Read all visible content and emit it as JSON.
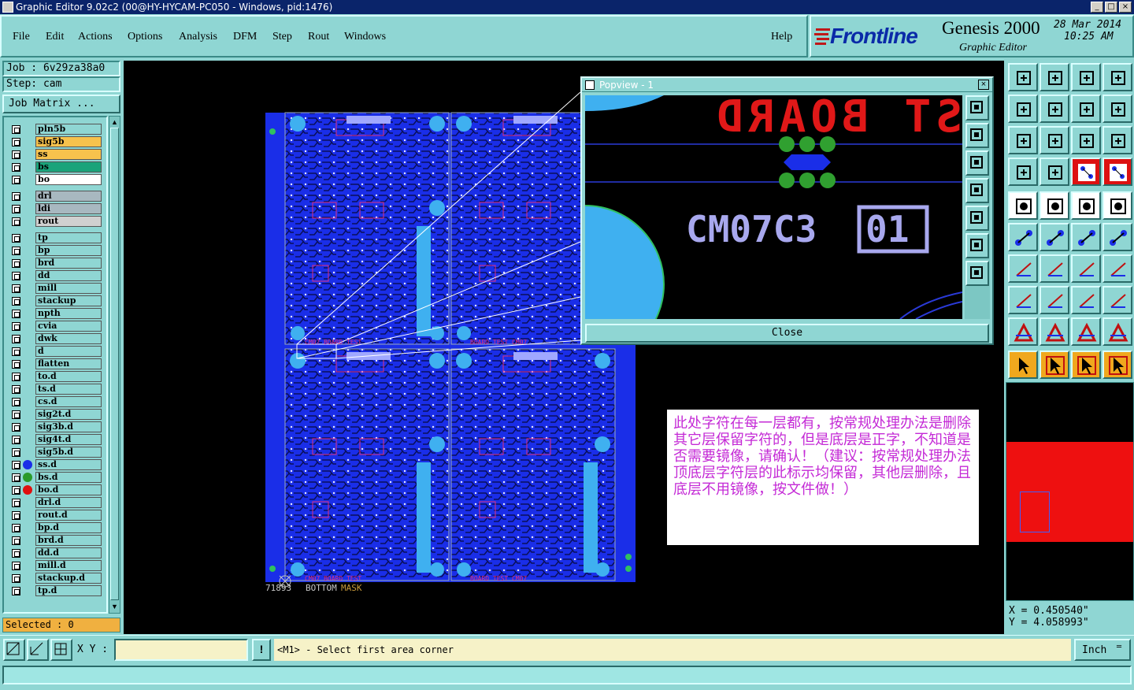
{
  "window": {
    "title": "Graphic Editor 9.02c2 (00@HY-HYCAM-PC050 - Windows, pid:1476)",
    "controls": [
      "_",
      "□",
      "×"
    ]
  },
  "menu": {
    "items": [
      "File",
      "Edit",
      "Actions",
      "Options",
      "Analysis",
      "DFM",
      "Step",
      "Rout",
      "Windows"
    ],
    "help": "Help"
  },
  "brand": {
    "logo": "Frontline",
    "product": "Genesis 2000",
    "subtitle": "Graphic Editor",
    "date": "28 Mar 2014",
    "time": "10:25 AM"
  },
  "job": {
    "job_label": "Job : 6v29za38a0",
    "step_label": "Step: cam",
    "matrix_button": "Job Matrix ..."
  },
  "layers": [
    {
      "name": "pln5b",
      "color": "#8fd6d3",
      "dot": ""
    },
    {
      "name": "sig5b",
      "color": "#f7c24d",
      "dot": ""
    },
    {
      "name": "ss",
      "color": "#f7c24d",
      "dot": ""
    },
    {
      "name": "bs",
      "color": "#1aa37a",
      "dot": ""
    },
    {
      "name": "bo",
      "color": "#ffffff",
      "dot": ""
    },
    {
      "name": "drl",
      "color": "#a8b8c0",
      "dot": ""
    },
    {
      "name": "ldi",
      "color": "#a8b8c0",
      "dot": ""
    },
    {
      "name": "rout",
      "color": "#d0d0d0",
      "dot": ""
    },
    {
      "name": "tp",
      "color": "#8fd6d3",
      "dot": ""
    },
    {
      "name": "bp",
      "color": "#8fd6d3",
      "dot": ""
    },
    {
      "name": "brd",
      "color": "#8fd6d3",
      "dot": ""
    },
    {
      "name": "dd",
      "color": "#8fd6d3",
      "dot": ""
    },
    {
      "name": "mill",
      "color": "#8fd6d3",
      "dot": ""
    },
    {
      "name": "stackup",
      "color": "#8fd6d3",
      "dot": ""
    },
    {
      "name": "npth",
      "color": "#8fd6d3",
      "dot": ""
    },
    {
      "name": "cvia",
      "color": "#8fd6d3",
      "dot": ""
    },
    {
      "name": "dwk",
      "color": "#8fd6d3",
      "dot": ""
    },
    {
      "name": "d",
      "color": "#8fd6d3",
      "dot": ""
    },
    {
      "name": "flatten",
      "color": "#8fd6d3",
      "dot": ""
    },
    {
      "name": "to.d",
      "color": "#8fd6d3",
      "dot": ""
    },
    {
      "name": "ts.d",
      "color": "#8fd6d3",
      "dot": ""
    },
    {
      "name": "cs.d",
      "color": "#8fd6d3",
      "dot": ""
    },
    {
      "name": "sig2t.d",
      "color": "#8fd6d3",
      "dot": ""
    },
    {
      "name": "sig3b.d",
      "color": "#8fd6d3",
      "dot": ""
    },
    {
      "name": "sig4t.d",
      "color": "#8fd6d3",
      "dot": ""
    },
    {
      "name": "sig5b.d",
      "color": "#8fd6d3",
      "dot": ""
    },
    {
      "name": "ss.d",
      "color": "#8fd6d3",
      "dot": "#1a2ee8"
    },
    {
      "name": "bs.d",
      "color": "#8fd6d3",
      "dot": "#2a9a2a"
    },
    {
      "name": "bo.d",
      "color": "#8fd6d3",
      "dot": "#e01010"
    },
    {
      "name": "drl.d",
      "color": "#8fd6d3",
      "dot": ""
    },
    {
      "name": "rout.d",
      "color": "#8fd6d3",
      "dot": ""
    },
    {
      "name": "bp.d",
      "color": "#8fd6d3",
      "dot": ""
    },
    {
      "name": "brd.d",
      "color": "#8fd6d3",
      "dot": ""
    },
    {
      "name": "dd.d",
      "color": "#8fd6d3",
      "dot": ""
    },
    {
      "name": "mill.d",
      "color": "#8fd6d3",
      "dot": ""
    },
    {
      "name": "stackup.d",
      "color": "#8fd6d3",
      "dot": ""
    },
    {
      "name": "tp.d",
      "color": "#8fd6d3",
      "dot": ""
    }
  ],
  "selected": "Selected : 0",
  "popview": {
    "title": "Popview - 1",
    "mirrored_text": "ST BOARD",
    "part_text": "CM07C3",
    "box_text": "01",
    "close_label": "Close"
  },
  "canvas": {
    "board_id": "71893",
    "layer_caption": "BOTTOM",
    "layer_caption2": "MASK",
    "silk_label": "CM07C3",
    "silk_box": "01"
  },
  "note": "此处字符在每一层都有，按常规处理办法是删除其它层保留字符的，但是底层是正字，不知道是否需要镜像，请确认！（建议：按常规处理办法顶底层字符层的此标示均保留，其他层删除，且底层不用镜像，按文件做！）",
  "coords": {
    "x": "X = 0.450540\"",
    "y": "Y = 4.058993\""
  },
  "statusbar": {
    "xy_label": "X Y :",
    "xy_value": "",
    "prompt": "<M1> - Select first area corner",
    "units": "Inch"
  }
}
